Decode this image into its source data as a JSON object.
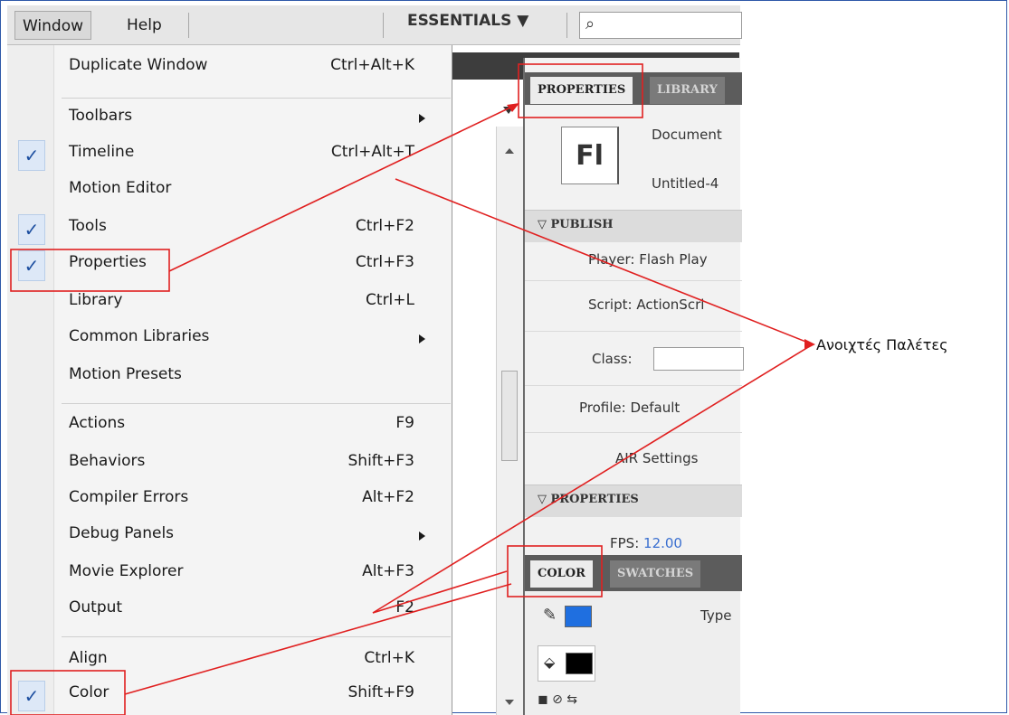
{
  "menubar": {
    "items": [
      "Window",
      "Help"
    ],
    "workspace": "ESSENTIALS ▼",
    "search_glyph": "⌕"
  },
  "menu": {
    "items": [
      {
        "label": "Duplicate Window",
        "shortcut": "Ctrl+Alt+K"
      },
      {
        "label": "Toolbars",
        "shortcut": ""
      },
      {
        "label": "Timeline",
        "shortcut": "Ctrl+Alt+T"
      },
      {
        "label": "Motion Editor",
        "shortcut": ""
      },
      {
        "label": "Tools",
        "shortcut": "Ctrl+F2"
      },
      {
        "label": "Properties",
        "shortcut": "Ctrl+F3"
      },
      {
        "label": "Library",
        "shortcut": "Ctrl+L"
      },
      {
        "label": "Common Libraries",
        "shortcut": ""
      },
      {
        "label": "Motion Presets",
        "shortcut": ""
      },
      {
        "label": "Actions",
        "shortcut": "F9"
      },
      {
        "label": "Behaviors",
        "shortcut": "Shift+F3"
      },
      {
        "label": "Compiler Errors",
        "shortcut": "Alt+F2"
      },
      {
        "label": "Debug Panels",
        "shortcut": ""
      },
      {
        "label": "Movie Explorer",
        "shortcut": "Alt+F3"
      },
      {
        "label": "Output",
        "shortcut": "F2"
      },
      {
        "label": "Align",
        "shortcut": "Ctrl+K"
      },
      {
        "label": "Color",
        "shortcut": "Shift+F9"
      }
    ],
    "check_glyph": "✓"
  },
  "properties_panel": {
    "tabs": [
      "PROPERTIES",
      "LIBRARY"
    ],
    "doc_icon_text": "Fl",
    "doc_type": "Document",
    "doc_name": "Untitled-4",
    "publish_header": "PUBLISH",
    "player": "Player: Flash Play",
    "script": "Script: ActionScri",
    "class_label": "Class:",
    "profile": "Profile: Default",
    "air_settings": "AIR Settings",
    "properties_header": "PROPERTIES",
    "fps_label": "FPS:",
    "fps_value": "12.00"
  },
  "color_panel": {
    "tabs": [
      "COLOR",
      "SWATCHES"
    ],
    "type_label": "Type"
  },
  "annotation": {
    "callout": "Ανοιχτές Παλέτες",
    "highlight_color": "#e02020"
  },
  "colors": {
    "stroke_swatch": "#1f6fe0",
    "fill_swatch": "#000000",
    "fps_value": "#3a6fd0"
  }
}
